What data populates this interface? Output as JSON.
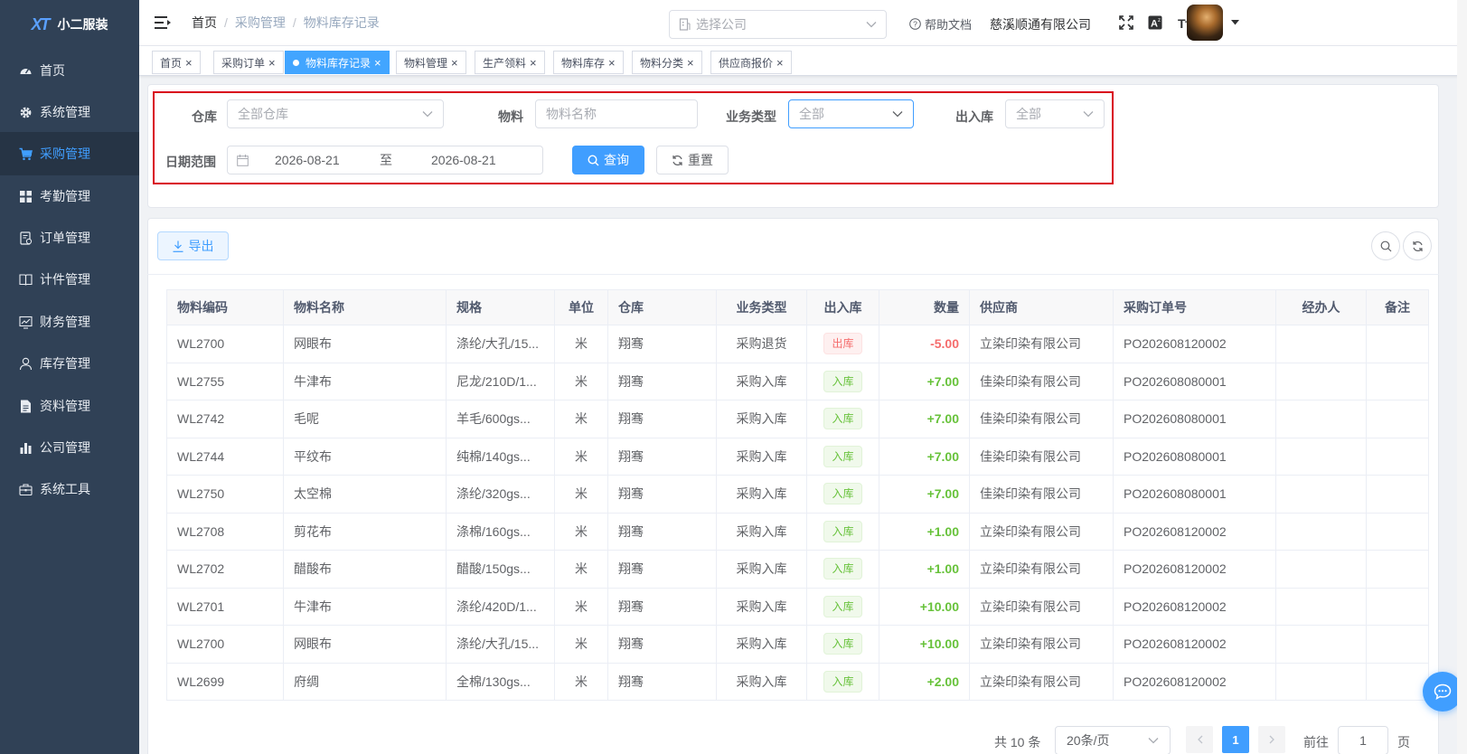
{
  "app": {
    "logo_text": "小二服装",
    "logo_mark": "XT"
  },
  "sidebar": {
    "items": [
      {
        "label": "首页",
        "icon": "dashboard-icon"
      },
      {
        "label": "系统管理",
        "icon": "gear-icon"
      },
      {
        "label": "采购管理",
        "icon": "cart-icon",
        "active": true
      },
      {
        "label": "考勤管理",
        "icon": "grid-icon"
      },
      {
        "label": "订单管理",
        "icon": "order-icon"
      },
      {
        "label": "计件管理",
        "icon": "book-icon"
      },
      {
        "label": "财务管理",
        "icon": "chart-monitor-icon"
      },
      {
        "label": "库存管理",
        "icon": "user-icon"
      },
      {
        "label": "资料管理",
        "icon": "document-icon"
      },
      {
        "label": "公司管理",
        "icon": "bar-chart-icon"
      },
      {
        "label": "系统工具",
        "icon": "toolbox-icon"
      }
    ]
  },
  "navbar": {
    "breadcrumb": [
      "首页",
      "采购管理",
      "物料库存记录"
    ],
    "company_select_placeholder": "选择公司",
    "help_label": "帮助文档",
    "company_name": "慈溪顺通有限公司"
  },
  "tags": [
    {
      "label": "首页"
    },
    {
      "label": "采购订单"
    },
    {
      "label": "物料库存记录",
      "active": true
    },
    {
      "label": "物料管理"
    },
    {
      "label": "生产领料"
    },
    {
      "label": "物料库存"
    },
    {
      "label": "物料分类"
    },
    {
      "label": "供应商报价"
    }
  ],
  "filters": {
    "warehouse_label": "仓库",
    "warehouse_placeholder": "全部仓库",
    "material_label": "物料",
    "material_placeholder": "物料名称",
    "biz_type_label": "业务类型",
    "biz_type_value": "全部",
    "inout_label": "出入库",
    "inout_value": "全部",
    "date_label": "日期范围",
    "date_start": "2026-08-21",
    "date_sep": "至",
    "date_end": "2026-08-21",
    "search_label": "查询",
    "reset_label": "重置"
  },
  "toolbar": {
    "export_label": "导出"
  },
  "table": {
    "headers": [
      "物料编码",
      "物料名称",
      "规格",
      "单位",
      "仓库",
      "业务类型",
      "出入库",
      "数量",
      "供应商",
      "采购订单号",
      "经办人",
      "备注"
    ],
    "rows": [
      {
        "code": "WL2700",
        "name": "网眼布",
        "spec": "涤纶/大孔/15...",
        "unit": "米",
        "warehouse": "翔骞",
        "biz": "采购退货",
        "dir": "出库",
        "dir_type": "out",
        "qty": "-5.00",
        "supplier": "立染印染有限公司",
        "po": "PO202608120002",
        "handler": "",
        "remark": ""
      },
      {
        "code": "WL2755",
        "name": "牛津布",
        "spec": "尼龙/210D/1...",
        "unit": "米",
        "warehouse": "翔骞",
        "biz": "采购入库",
        "dir": "入库",
        "dir_type": "in",
        "qty": "+7.00",
        "supplier": "佳染印染有限公司",
        "po": "PO202608080001",
        "handler": "",
        "remark": ""
      },
      {
        "code": "WL2742",
        "name": "毛呢",
        "spec": "羊毛/600gs...",
        "unit": "米",
        "warehouse": "翔骞",
        "biz": "采购入库",
        "dir": "入库",
        "dir_type": "in",
        "qty": "+7.00",
        "supplier": "佳染印染有限公司",
        "po": "PO202608080001",
        "handler": "",
        "remark": ""
      },
      {
        "code": "WL2744",
        "name": "平纹布",
        "spec": "纯棉/140gs...",
        "unit": "米",
        "warehouse": "翔骞",
        "biz": "采购入库",
        "dir": "入库",
        "dir_type": "in",
        "qty": "+7.00",
        "supplier": "佳染印染有限公司",
        "po": "PO202608080001",
        "handler": "",
        "remark": ""
      },
      {
        "code": "WL2750",
        "name": "太空棉",
        "spec": "涤纶/320gs...",
        "unit": "米",
        "warehouse": "翔骞",
        "biz": "采购入库",
        "dir": "入库",
        "dir_type": "in",
        "qty": "+7.00",
        "supplier": "佳染印染有限公司",
        "po": "PO202608080001",
        "handler": "",
        "remark": ""
      },
      {
        "code": "WL2708",
        "name": "剪花布",
        "spec": "涤棉/160gs...",
        "unit": "米",
        "warehouse": "翔骞",
        "biz": "采购入库",
        "dir": "入库",
        "dir_type": "in",
        "qty": "+1.00",
        "supplier": "立染印染有限公司",
        "po": "PO202608120002",
        "handler": "",
        "remark": ""
      },
      {
        "code": "WL2702",
        "name": "醋酸布",
        "spec": "醋酸/150gs...",
        "unit": "米",
        "warehouse": "翔骞",
        "biz": "采购入库",
        "dir": "入库",
        "dir_type": "in",
        "qty": "+1.00",
        "supplier": "立染印染有限公司",
        "po": "PO202608120002",
        "handler": "",
        "remark": ""
      },
      {
        "code": "WL2701",
        "name": "牛津布",
        "spec": "涤纶/420D/1...",
        "unit": "米",
        "warehouse": "翔骞",
        "biz": "采购入库",
        "dir": "入库",
        "dir_type": "in",
        "qty": "+10.00",
        "supplier": "立染印染有限公司",
        "po": "PO202608120002",
        "handler": "",
        "remark": ""
      },
      {
        "code": "WL2700",
        "name": "网眼布",
        "spec": "涤纶/大孔/15...",
        "unit": "米",
        "warehouse": "翔骞",
        "biz": "采购入库",
        "dir": "入库",
        "dir_type": "in",
        "qty": "+10.00",
        "supplier": "立染印染有限公司",
        "po": "PO202608120002",
        "handler": "",
        "remark": ""
      },
      {
        "code": "WL2699",
        "name": "府绸",
        "spec": "全棉/130gs...",
        "unit": "米",
        "warehouse": "翔骞",
        "biz": "采购入库",
        "dir": "入库",
        "dir_type": "in",
        "qty": "+2.00",
        "supplier": "立染印染有限公司",
        "po": "PO202608120002",
        "handler": "",
        "remark": ""
      }
    ]
  },
  "pagination": {
    "total_label": "共 10 条",
    "page_size": "20条/页",
    "current_page": "1",
    "goto_label": "前往",
    "goto_value": "1",
    "page_suffix": "页"
  },
  "colors": {
    "primary": "#409eff",
    "sidebar_bg": "#304156",
    "success": "#67c23a",
    "danger": "#f56c6c",
    "highlight_border": "#d9001b"
  }
}
